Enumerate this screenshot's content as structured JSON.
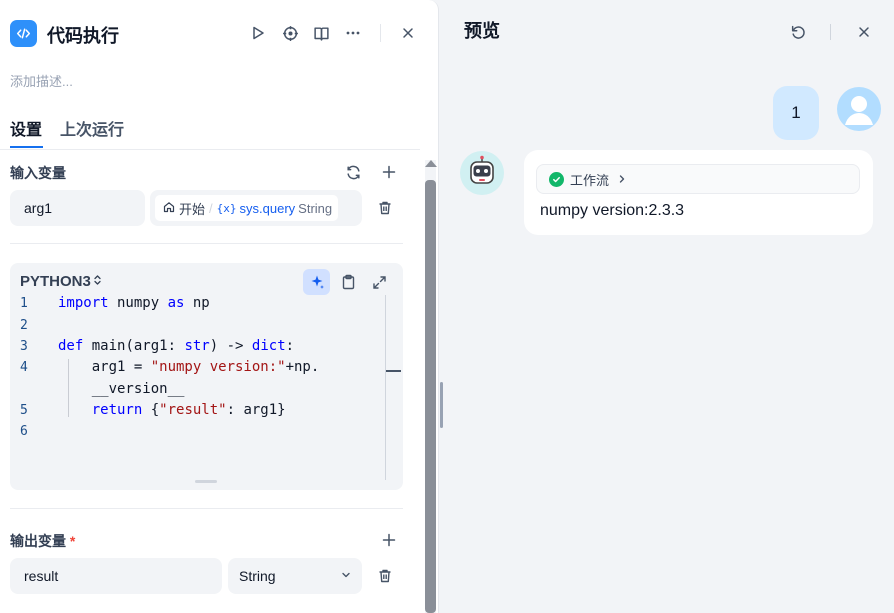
{
  "left_panel": {
    "title": "代码执行",
    "description_placeholder": "添加描述...",
    "tabs": [
      {
        "label": "设置",
        "active": true
      },
      {
        "label": "上次运行",
        "active": false
      }
    ],
    "input_vars": {
      "label": "输入变量",
      "rows": [
        {
          "name": "arg1",
          "source_node": "开始",
          "var_prefix": "{x}",
          "var_name": "sys.query",
          "var_type": "String"
        }
      ]
    },
    "code": {
      "language": "PYTHON3",
      "lines": [
        {
          "n": "1",
          "text": "import numpy as np"
        },
        {
          "n": "2",
          "text": ""
        },
        {
          "n": "3",
          "text": "def main(arg1: str) -> dict:"
        },
        {
          "n": "4",
          "text": "    arg1 = \"numpy version:\"+np."
        },
        {
          "n": "",
          "text": "    __version__"
        },
        {
          "n": "5",
          "text": "    return {\"result\": arg1}"
        },
        {
          "n": "6",
          "text": ""
        }
      ]
    },
    "output_vars": {
      "label": "输出变量",
      "required_mark": "*",
      "rows": [
        {
          "name": "result",
          "type": "String"
        }
      ]
    }
  },
  "right_panel": {
    "title": "预览",
    "user_message": "1",
    "bot": {
      "workflow_label": "工作流",
      "workflow_status": "success",
      "answer": "numpy version:2.3.3"
    }
  },
  "colors": {
    "accent": "#2e90fa",
    "link": "#155eef",
    "success": "#12b76a",
    "user_bubble": "#d1e9ff"
  }
}
